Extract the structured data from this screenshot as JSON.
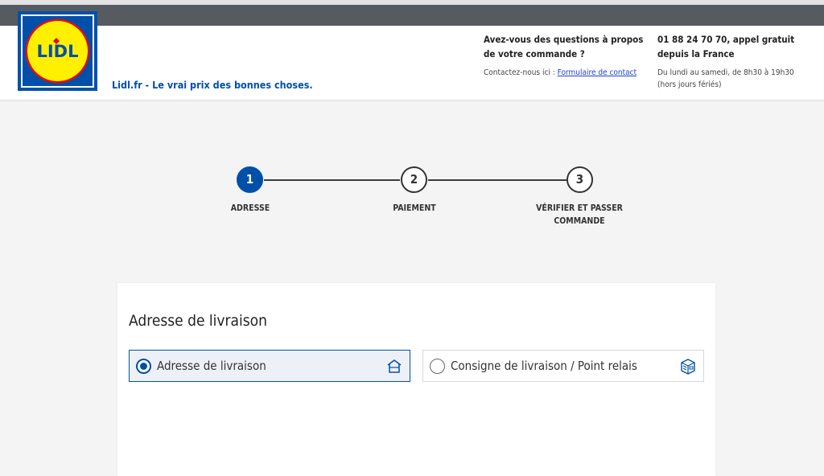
{
  "header": {
    "logo_text": "LIDL",
    "tagline": "Lidl.fr - Le vrai prix des bonnes choses.",
    "help": {
      "question": "Avez-vous des questions à propos de votre commande ?",
      "contact_prefix": "Contactez-nous ici : ",
      "contact_link": "Formulaire de contact"
    },
    "phone": {
      "line": "01 88 24 70 70, appel gratuit depuis la France",
      "hours": "Du lundi au samedi, de 8h30 à 19h30 (hors jours fériés)"
    }
  },
  "stepper": {
    "steps": [
      {
        "number": "1",
        "label": "ADRESSE",
        "active": true
      },
      {
        "number": "2",
        "label": "PAIEMENT",
        "active": false
      },
      {
        "number": "3",
        "label": "VÉRIFIER ET PASSER COMMANDE",
        "active": false
      }
    ]
  },
  "delivery": {
    "title": "Adresse de livraison",
    "options": [
      {
        "label": "Adresse de livraison",
        "icon": "house-icon",
        "selected": true
      },
      {
        "label": "Consigne de livraison / Point relais",
        "icon": "parcel-locker-icon",
        "selected": false
      }
    ]
  },
  "colors": {
    "brand_blue": "#0050aa",
    "logo_yellow": "#fff000",
    "logo_red": "#e60a14",
    "link_blue": "#1d3fd8"
  }
}
